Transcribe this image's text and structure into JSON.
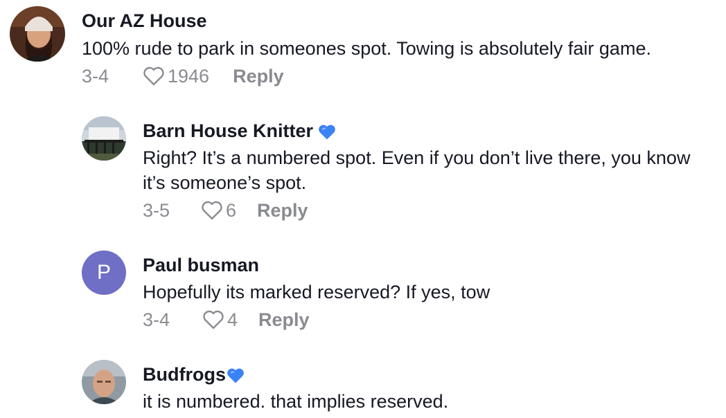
{
  "comments": [
    {
      "author": "Our AZ House",
      "text": "100% rude to park in someones spot. Towing is absolutely fair game.",
      "date": "3-4",
      "likes": "1946",
      "reply_label": "Reply"
    },
    {
      "author": "Barn House Knitter",
      "text": "Right? It’s a numbered spot. Even if you don’t live there, you know it’s someone’s spot.",
      "date": "3-5",
      "likes": "6",
      "reply_label": "Reply"
    },
    {
      "author": "Paul busman",
      "avatar_letter": "P",
      "text": "Hopefully its marked reserved? If yes, tow",
      "date": "3-4",
      "likes": "4",
      "reply_label": "Reply"
    },
    {
      "author": "Budfrogs",
      "text": "it is numbered. that implies reserved."
    }
  ],
  "colors": {
    "text": "#161823",
    "meta": "#8a8b91",
    "blue_heart": "#3b82f6",
    "letter_avatar_bg": "#6e6fc5"
  },
  "icons": {
    "like": "heart-outline-icon",
    "badge": "blue-heart-emoji"
  }
}
